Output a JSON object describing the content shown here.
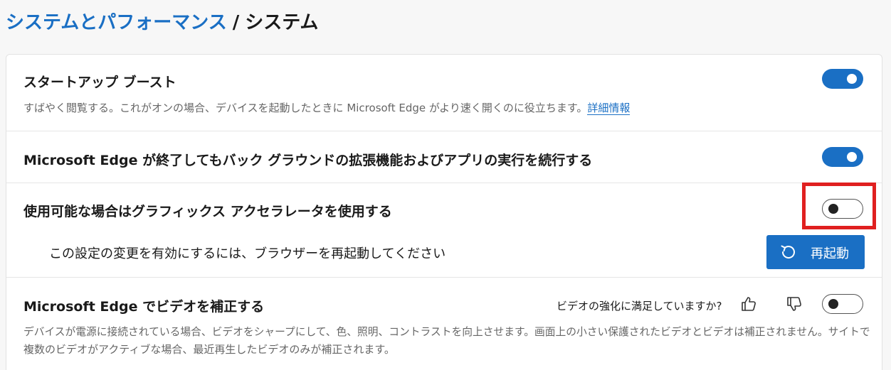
{
  "breadcrumb": {
    "parent": "システムとパフォーマンス",
    "separator": "/",
    "current": "システム"
  },
  "settings": {
    "startup_boost": {
      "title": "スタートアップ ブースト",
      "description": "すばやく閲覧する。これがオンの場合、デバイスを起動したときに Microsoft Edge がより速く開くのに役立ちます。",
      "link": "詳細情報",
      "enabled": true
    },
    "background_apps": {
      "title": "Microsoft Edge が終了してもバック グラウンドの拡張機能およびアプリの実行を続行する",
      "enabled": true
    },
    "hardware_acceleration": {
      "title": "使用可能な場合はグラフィックス アクセラレータを使用する",
      "enabled": false,
      "restart_note": "この設定の変更を有効にするには、ブラウザーを再起動してください",
      "restart_button": "再起動"
    },
    "video_enhance": {
      "title": "Microsoft Edge でビデオを補正する",
      "feedback_question": "ビデオの強化に満足していますか?",
      "description_line1": "デバイスが電源に接続されている場合、ビデオをシャープにして、色、照明、コントラストを向上させます。画面上の小さい保護されたビデオとビデオは補正されません。サイトで",
      "description_line2": "複数のビデオがアクティブな場合、最近再生したビデオのみが補正されます。",
      "enabled": false
    }
  },
  "colors": {
    "accent": "#1a6fc4",
    "highlight": "#e02020"
  }
}
